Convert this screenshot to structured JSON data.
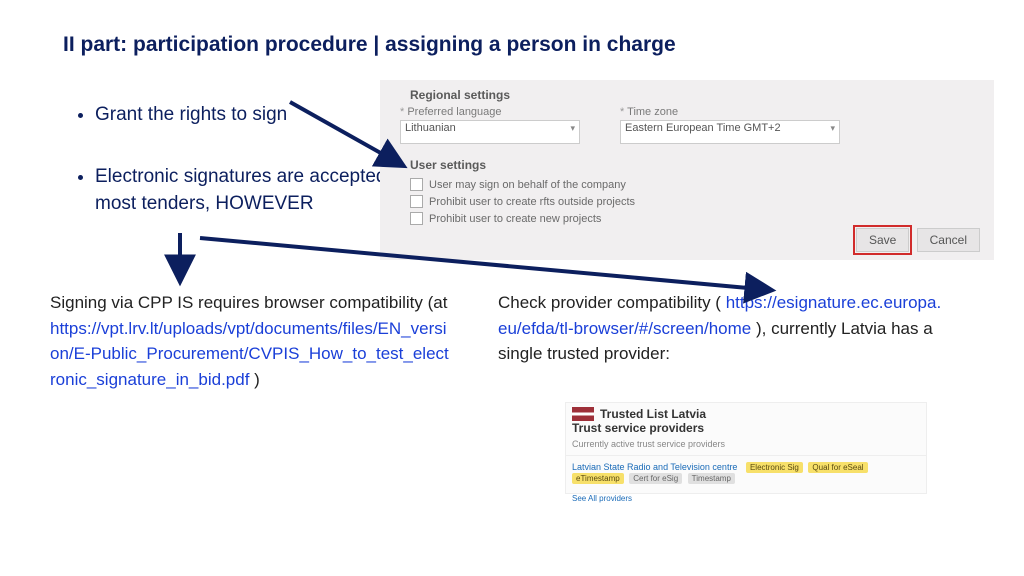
{
  "title": "II part: participation procedure | assigning a person in charge",
  "bullets": {
    "b1": "Grant the rights to sign",
    "b2": "Electronic signatures are accepted in most tenders, HOWEVER"
  },
  "left": {
    "pre": "Signing via CPP IS requires browser compatibility (at ",
    "link": "https://vpt.lrv.lt/uploads/vpt/documents/files/EN_version/E-Public_Procurement/CVPIS_How_to_test_electronic_signature_in_bid.pdf",
    "post": ")"
  },
  "right": {
    "pre": "Check provider compatibility (",
    "link": "https://esignature.ec.europa.eu/efda/tl-browser/#/screen/home",
    "post": "), currently Latvia has a single trusted provider:"
  },
  "settings": {
    "regional_title": "Regional settings",
    "user_title": "User settings",
    "lang_label": "Preferred language",
    "lang_value": "Lithuanian",
    "tz_label": "Time zone",
    "tz_value": "Eastern European Time GMT+2",
    "chk1": "User may sign on behalf of the company",
    "chk2": "Prohibit user to create rfts outside projects",
    "chk3": "Prohibit user to create new projects",
    "save": "Save",
    "cancel": "Cancel"
  },
  "trusted": {
    "title": "Trusted List Latvia",
    "sub": "Trust service providers",
    "caption": "Currently active trust service providers",
    "provider": "Latvian State Radio and Television centre",
    "tag1": "Electronic Sig",
    "tag2": "Qual for eSeal",
    "tag3": "eTimestamp",
    "tag4": "Cert for eSig",
    "tag5": "Timestamp",
    "foot": "See All providers"
  }
}
